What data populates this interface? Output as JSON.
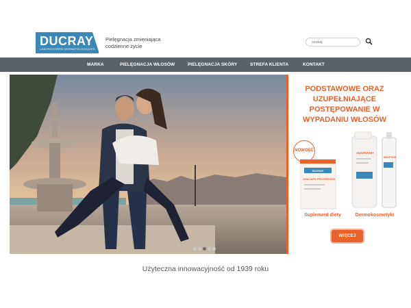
{
  "header": {
    "logo_brand": "DUCRAY",
    "logo_sub": "LABORATOIRES DERMATOLOGIQUES",
    "tagline": "Pielęgnacja zmieniająca codzienne życie",
    "search_placeholder": "szukaj",
    "search_icon": "search-icon"
  },
  "nav": {
    "items": [
      {
        "label": "MARKA"
      },
      {
        "label": "PIELĘGNACJA WŁOSÓW"
      },
      {
        "label": "PIELĘGNACJA SKÓRY"
      },
      {
        "label": "STREFA KLIENTA"
      },
      {
        "label": "KONTAKT"
      }
    ]
  },
  "promo": {
    "title": "PODSTAWOWE ORAZ UZUPEŁNIAJĄCE POSTĘPOWANIE W WYPADANIU WŁOSÓW",
    "badge": "NOWOŚĆ",
    "product1_brand": "ANACAPS PROGRESSIV",
    "product2_brand": "ANAPHASE+",
    "product3_brand": "NEOPTIDE",
    "box_brand": "DUCRAY",
    "label_left": "Suplement diety",
    "label_right": "Dermokosmetyki",
    "button": "WIĘCEJ"
  },
  "slider": {
    "count": 5,
    "active": 3
  },
  "motto": "Użyteczna innowacyjność od 1939 roku",
  "colors": {
    "brand_blue": "#3b87b8",
    "accent_orange": "#e8622a",
    "nav_bg": "#5b6369"
  }
}
